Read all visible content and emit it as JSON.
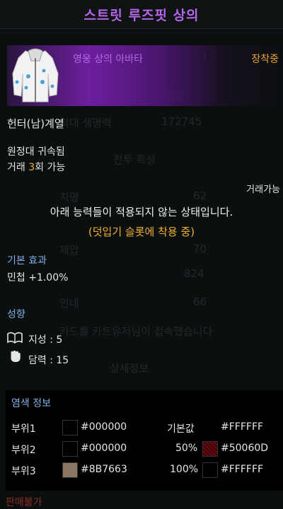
{
  "title": "스트릿 루즈핏 상의",
  "header": {
    "item_type": "영웅 상의 아바타",
    "equip_status": "장착중"
  },
  "colors": {
    "title": "#b466e8",
    "equip": "#f0a030",
    "section": "#7fb0e6",
    "notice_sub": "#f0b030"
  },
  "class_line": "헌터(남)계열",
  "bind": {
    "line1": "원정대 귀속됨",
    "trade_prefix": "거래 ",
    "trade_count": "3",
    "trade_suffix": "회 가능"
  },
  "tradeable": "거래가능",
  "notice": {
    "main": "아래 능력들이 적용되지 않는 상태입니다.",
    "sub": "(덧입기 슬롯에 착용 중)"
  },
  "basic_effect": {
    "label": "기본 효과",
    "value": "민첩 +1.00%"
  },
  "tendency": {
    "label": "성향",
    "items": [
      {
        "icon": "book-icon",
        "text": "지성 : 5"
      },
      {
        "icon": "fist-icon",
        "text": "담력 : 15"
      }
    ]
  },
  "dye": {
    "title": "염색 정보",
    "default_label": "기본값",
    "rows": [
      {
        "part": "부위1",
        "color": "#000000",
        "left_hex": "#000000",
        "pct": "",
        "right_hex": "#FFFFFF",
        "right_color": "#000000"
      },
      {
        "part": "부위2",
        "color": "#000000",
        "left_hex": "#000000",
        "pct": "50%",
        "right_hex": "#50060D",
        "right_color": "#50060D"
      },
      {
        "part": "부위3",
        "color": "#8B7663",
        "left_hex": "#8B7663",
        "pct": "100%",
        "right_hex": "#FFFFFF",
        "right_color": "#000000"
      }
    ]
  },
  "bottom_peek": "판매불가"
}
